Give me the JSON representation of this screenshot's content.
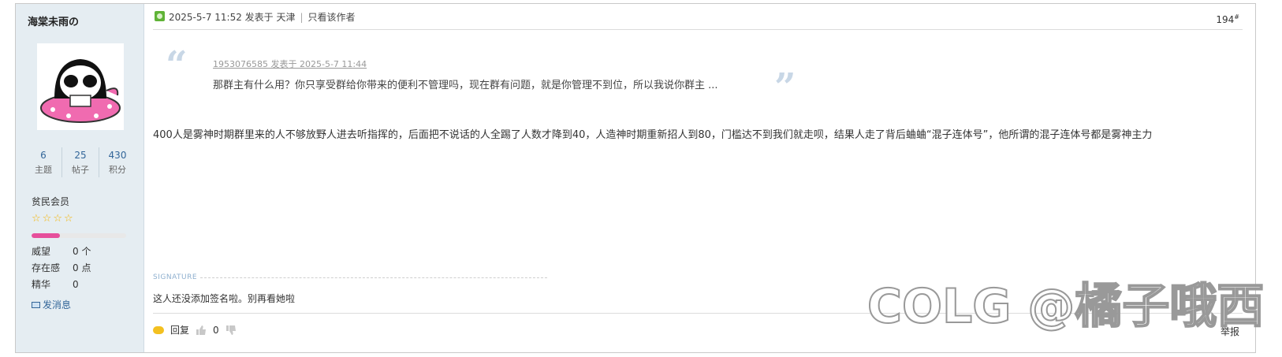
{
  "author": {
    "name": "海棠未雨の",
    "stats": [
      {
        "value": "6",
        "label": "主题"
      },
      {
        "value": "25",
        "label": "帖子"
      },
      {
        "value": "430",
        "label": "积分"
      }
    ],
    "group": "贫民会员",
    "stars": 4,
    "progress_fraction": 0.3,
    "progress_color": "#e64f9b",
    "attributes": [
      {
        "key": "威望",
        "value": "0 个"
      },
      {
        "key": "存在感",
        "value": "0 点"
      },
      {
        "key": "精华",
        "value": "0"
      }
    ],
    "send_message": "发消息"
  },
  "post": {
    "datetime": "2025-5-7 11:52 发表于 天津",
    "only_author": "只看该作者",
    "floor": "194",
    "floor_suffix": "#",
    "quote": {
      "author_line": "1953076585 发表于 2025-5-7 11:44",
      "text": "那群主有什么用？你只享受群给你带来的便利不管理吗，现在群有问题，就是你管理不到位，所以我说你群主 ..."
    },
    "body": "400人是雾神时期群里来的人不够放野人进去听指挥的，后面把不说话的人全踢了人数才降到40，人造神时期重新招人到80，门槛达不到我们就走呗，结果人走了背后蛐蛐“混子连体号”，他所谓的混子连体号都是雾神主力",
    "signature_label": "SIGNATURE",
    "signature": "这人还没添加签名啦。别再看她啦"
  },
  "footer": {
    "reply": "回复",
    "likes": "0",
    "report": "举报"
  },
  "watermark": "COLG @橘子哦西",
  "colors": {
    "sidebar_bg": "#e5edf2",
    "link": "#336699",
    "online": "#5fb336"
  }
}
